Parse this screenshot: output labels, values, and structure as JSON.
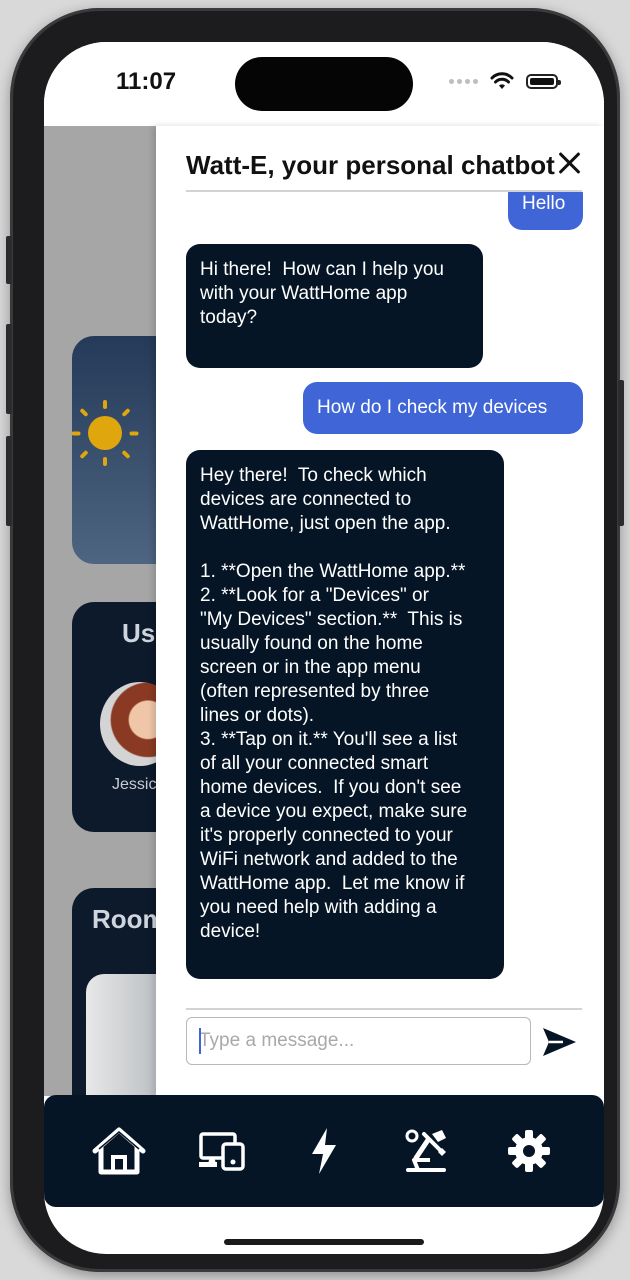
{
  "status_bar": {
    "time": "11:07"
  },
  "background": {
    "users_title": "Use",
    "user_name": "Jessic",
    "rooms_title": "Room"
  },
  "chat": {
    "title": "Watt-E, your personal chatbot",
    "messages": [
      {
        "role": "user",
        "text": "Hello"
      },
      {
        "role": "bot",
        "text": "Hi there!  How can I help you\nwith your WattHome app\ntoday?"
      },
      {
        "role": "user",
        "text": "How do I check my devices"
      },
      {
        "role": "bot",
        "text": "Hey there!  To check which\ndevices are connected to\nWattHome, just open the app.\n\n1. **Open the WattHome app.**\n2. **Look for a \"Devices\" or\n\"My Devices\" section.**  This is\nusually found on the home\nscreen or in the app menu\n(often represented by three\nlines or dots).\n3. **Tap on it.** You'll see a list\nof all your connected smart\nhome devices.  If you don't see\na device you expect, make sure\nit's properly connected to your\nWiFi network and added to the\nWattHome app.  Let me know if\nyou need help with adding a\ndevice!"
      }
    ],
    "input_placeholder": "Type a message...",
    "input_value": ""
  },
  "tabbar": {
    "tabs": [
      {
        "icon": "home-icon",
        "active": true
      },
      {
        "icon": "devices-icon",
        "active": false
      },
      {
        "icon": "energy-bolt-icon",
        "active": false
      },
      {
        "icon": "tools-icon",
        "active": false
      },
      {
        "icon": "settings-gear-icon",
        "active": false
      }
    ]
  },
  "colors": {
    "user_bubble": "#3f65d6",
    "bot_bubble": "#061526",
    "tabbar": "#061526"
  }
}
